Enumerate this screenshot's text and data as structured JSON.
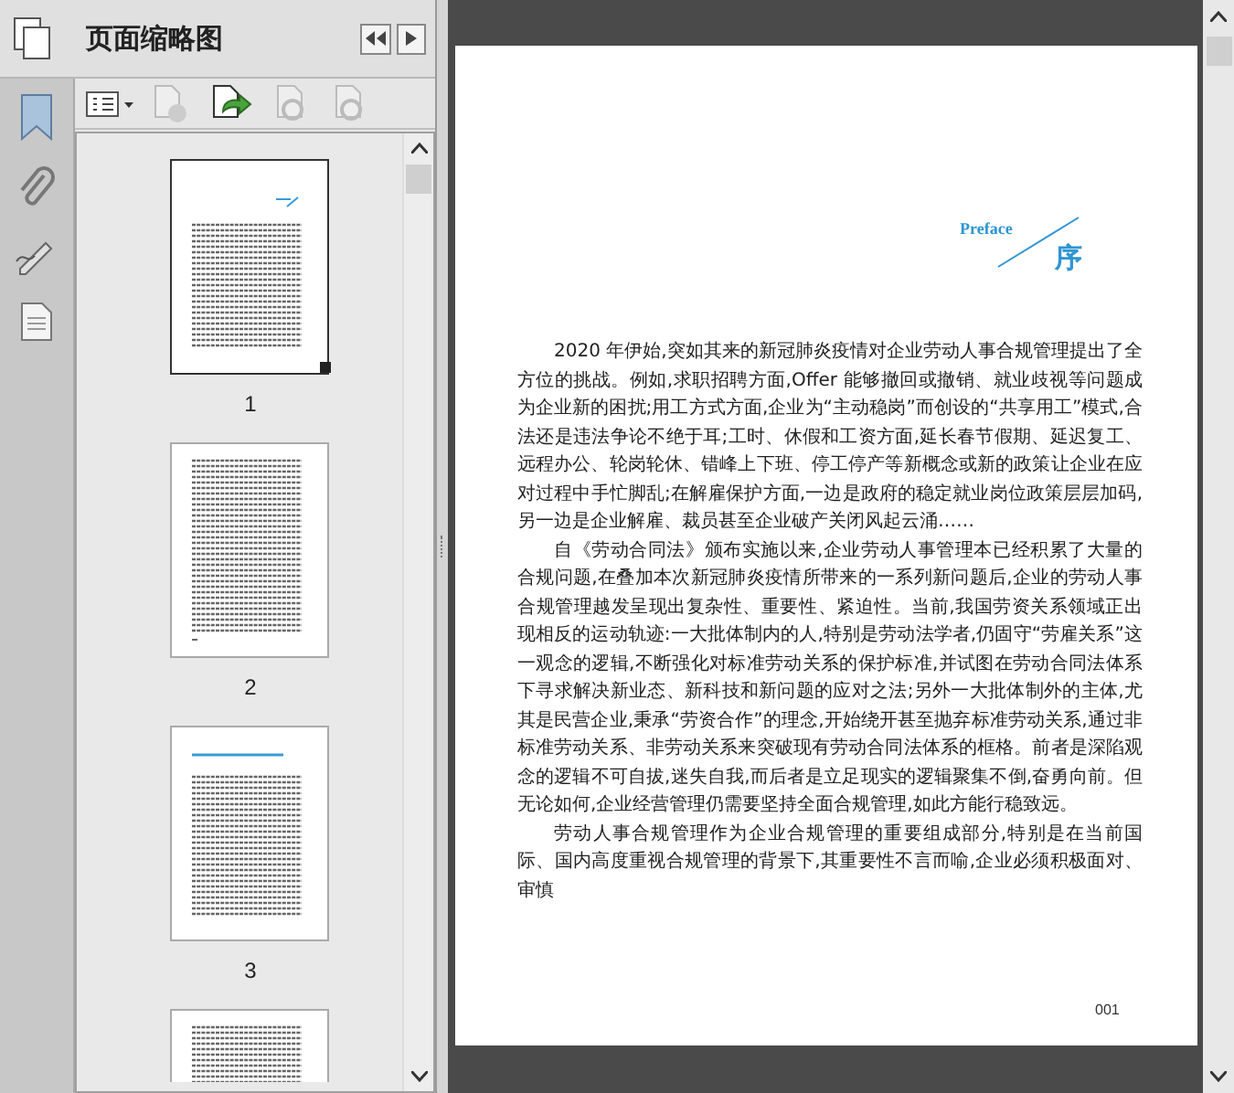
{
  "panel": {
    "title": "页面缩略图"
  },
  "thumbnails": [
    {
      "label": "1",
      "kind": "preface",
      "selected": true
    },
    {
      "label": "2",
      "kind": "text",
      "selected": false
    },
    {
      "label": "3",
      "kind": "chapter",
      "selected": false
    },
    {
      "kind": "partial",
      "selected": false
    }
  ],
  "page": {
    "heading_latin": "Preface",
    "heading": "序",
    "paragraphs": [
      "2020 年伊始,突如其来的新冠肺炎疫情对企业劳动人事合规管理提出了全方位的挑战。例如,求职招聘方面,Offer 能够撤回或撤销、就业歧视等问题成为企业新的困扰;用工方式方面,企业为“主动稳岗”而创设的“共享用工”模式,合法还是违法争论不绝于耳;工时、休假和工资方面,延长春节假期、延迟复工、远程办公、轮岗轮休、错峰上下班、停工停产等新概念或新的政策让企业在应对过程中手忙脚乱;在解雇保护方面,一边是政府的稳定就业岗位政策层层加码,另一边是企业解雇、裁员甚至企业破产关闭风起云涌……",
      "自《劳动合同法》颁布实施以来,企业劳动人事管理本已经积累了大量的合规问题,在叠加本次新冠肺炎疫情所带来的一系列新问题后,企业的劳动人事合规管理越发呈现出复杂性、重要性、紧迫性。当前,我国劳资关系领域正出现相反的运动轨迹:一大批体制内的人,特别是劳动法学者,仍固守“劳雇关系”这一观念的逻辑,不断强化对标准劳动关系的保护标准,并试图在劳动合同法体系下寻求解决新业态、新科技和新问题的应对之法;另外一大批体制外的主体,尤其是民营企业,秉承“劳资合作”的理念,开始绕开甚至抛弃标准劳动关系,通过非标准劳动关系、非劳动关系来突破现有劳动合同法体系的框格。前者是深陷观念的逻辑不可自拔,迷失自我,而后者是立足现实的逻辑聚集不倒,奋勇向前。但无论如何,企业经营管理仍需要坚持全面合规管理,如此方能行稳致远。",
      "劳动人事合规管理作为企业合规管理的重要组成部分,特别是在当前国际、国内高度重视合规管理的背景下,其重要性不言而喻,企业必须积极面对、审慎"
    ],
    "page_number": "001"
  }
}
